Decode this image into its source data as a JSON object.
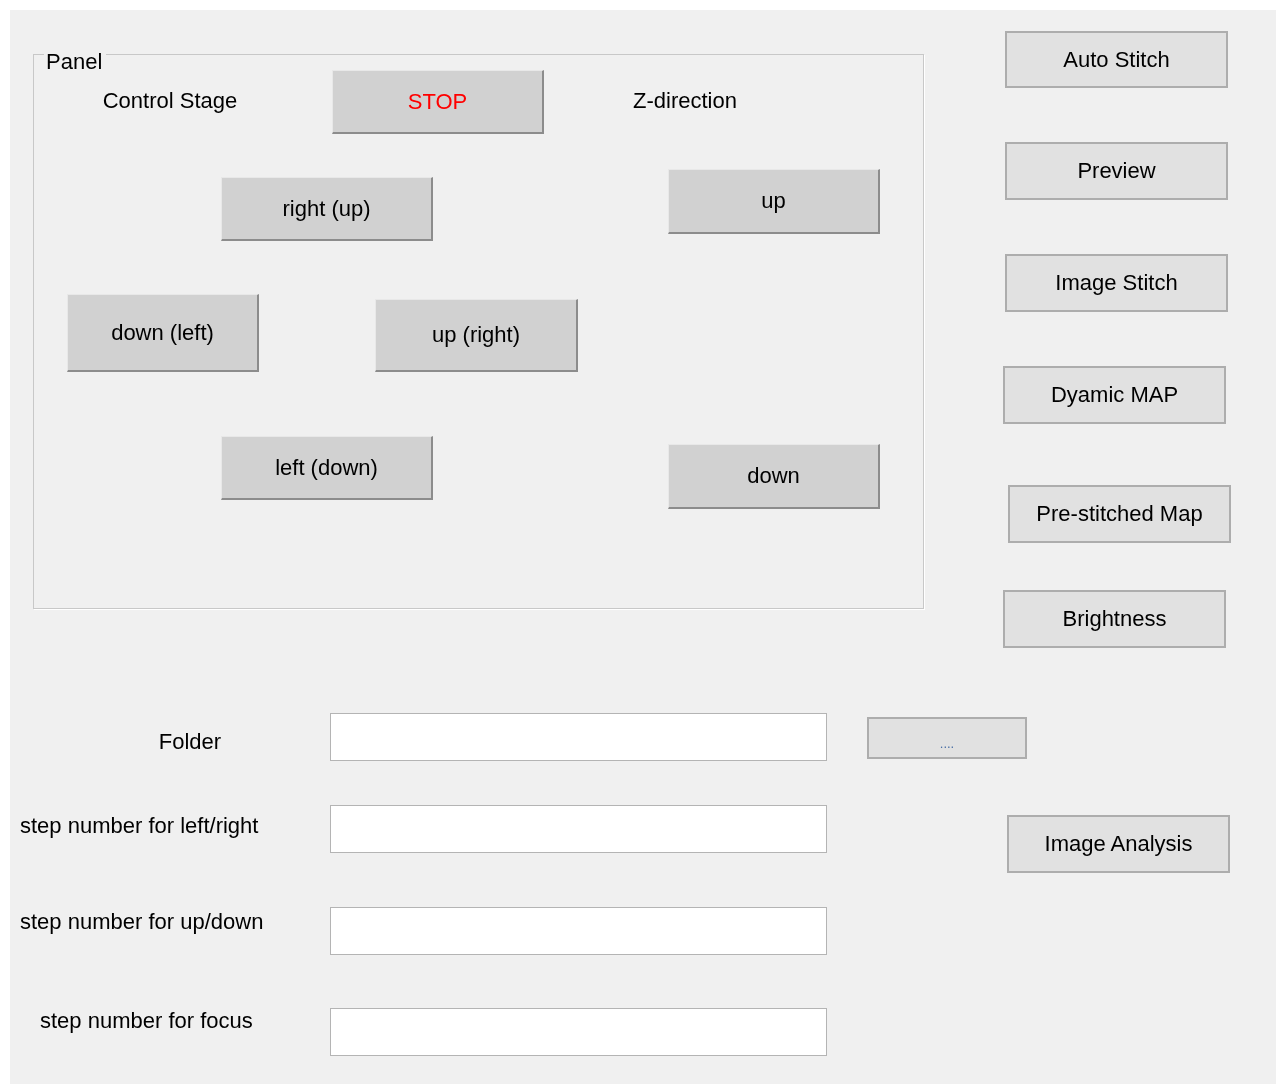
{
  "panel": {
    "title": "Panel",
    "labels": [
      "Control Stage",
      "Z-direction"
    ],
    "buttons": [
      {
        "label": "STOP",
        "kind": "stop"
      },
      {
        "label": "right (up)",
        "kind": "normal"
      },
      {
        "label": "up",
        "kind": "normal"
      },
      {
        "label": "down (left)",
        "kind": "normal"
      },
      {
        "label": "up (right)",
        "kind": "normal"
      },
      {
        "label": "left (down)",
        "kind": "normal"
      },
      {
        "label": "down",
        "kind": "normal"
      }
    ]
  },
  "side_buttons": [
    "Auto Stitch",
    "Preview",
    "Image Stitch",
    "Dyamic MAP",
    "Pre-stitched Map",
    "Brightness",
    "Image Analysis"
  ],
  "browse_button": "....",
  "fields": [
    {
      "label": "Folder"
    },
    {
      "label": "step number for left/right"
    },
    {
      "label": "step number for up/down"
    },
    {
      "label": "step number for focus"
    }
  ]
}
